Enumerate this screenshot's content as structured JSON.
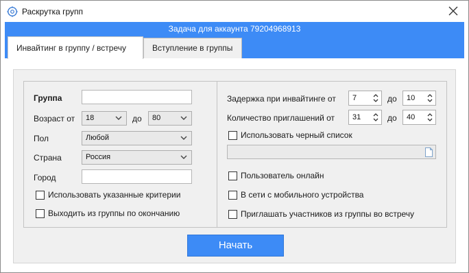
{
  "window": {
    "title": "Раскрутка групп",
    "task_banner": "Задача для аккаунта 79204968913"
  },
  "tabs": [
    {
      "label": "Инвайтинг в группу / встречу",
      "active": true
    },
    {
      "label": "Вступление в группы",
      "active": false
    }
  ],
  "left": {
    "group_label": "Группа",
    "group_value": "",
    "age_label": "Возраст от",
    "age_from": "18",
    "age_to_label": "до",
    "age_to": "80",
    "sex_label": "Пол",
    "sex_value": "Любой",
    "country_label": "Страна",
    "country_value": "Россия",
    "city_label": "Город",
    "city_value": "",
    "use_criteria_label": "Использовать указанные критерии",
    "use_criteria_checked": false,
    "leave_group_label": "Выходить из группы по окончанию",
    "leave_group_checked": false
  },
  "right": {
    "delay_label": "Задержка при инвайтинге от",
    "delay_from": "7",
    "delay_to_label": "до",
    "delay_to": "10",
    "invites_label": "Количество приглашений от",
    "invites_from": "31",
    "invites_to_label": "до",
    "invites_to": "40",
    "blacklist_label": "Использовать черный список",
    "blacklist_checked": false,
    "blacklist_path": "",
    "online_label": "Пользователь онлайн",
    "online_checked": false,
    "mobile_label": "В сети с мобильного устройства",
    "mobile_checked": false,
    "invite_members_label": "Приглашать участников из группы во встречу",
    "invite_members_checked": false
  },
  "actions": {
    "start_label": "Начать"
  },
  "colors": {
    "accent": "#3d8bf6",
    "panel": "#f0f0f0"
  },
  "icons": {
    "title": "gear-icon",
    "close": "close-icon",
    "dropdown": "chevron-down-icon",
    "spinner": "spinner-arrows-icon",
    "file": "document-icon"
  }
}
